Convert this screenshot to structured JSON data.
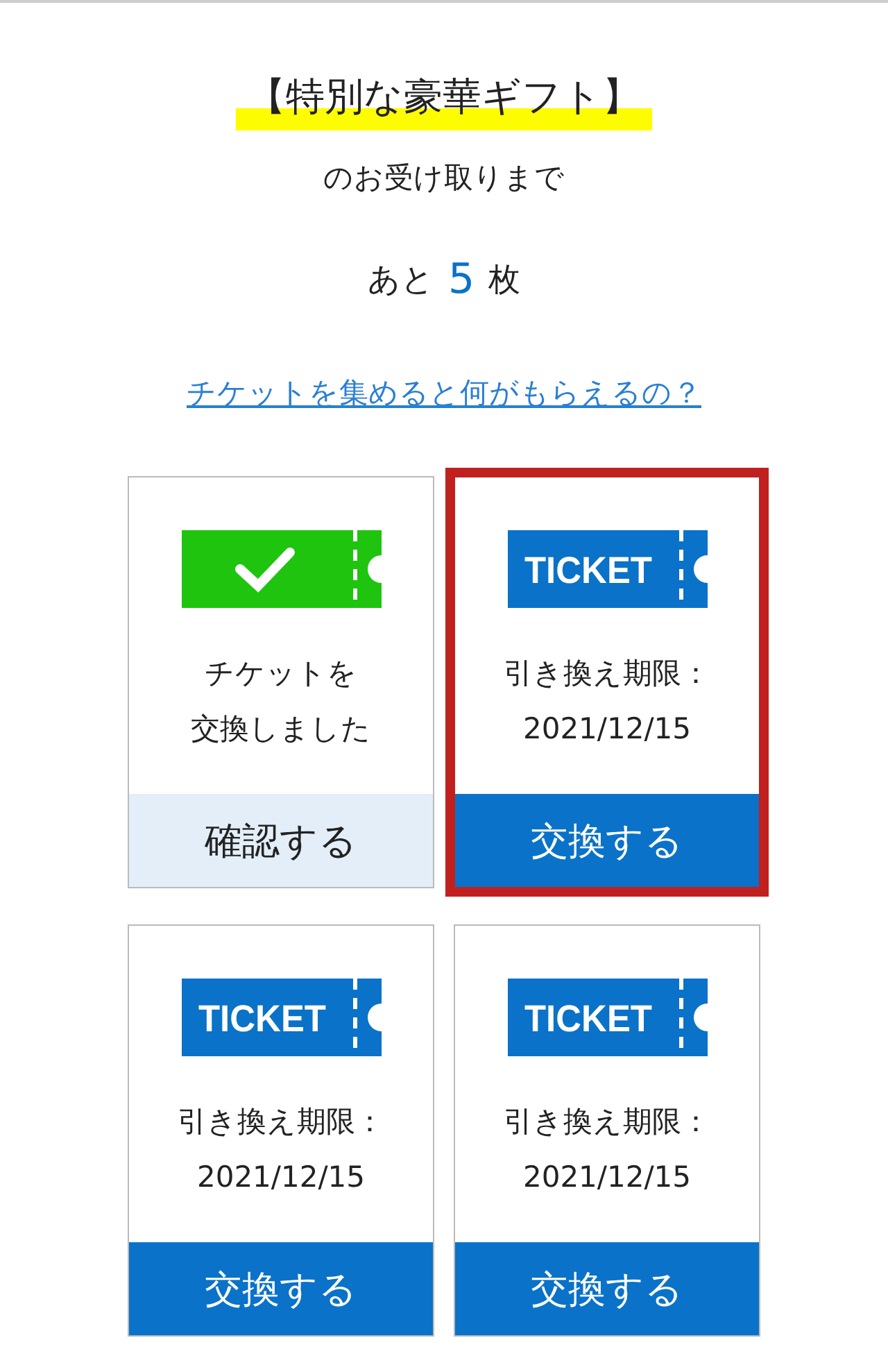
{
  "title": "【特別な豪華ギフト】",
  "subtitle": "のお受け取りまで",
  "remaining": {
    "prefix": "あと",
    "count": "5",
    "suffix": "枚"
  },
  "help_link": "チケットを集めると何がもらえるの？",
  "ticket_icon_labels": [
    "TICKET",
    "TICKET",
    "TICKET"
  ],
  "cards": [
    {
      "kind": "exchanged",
      "selected": false,
      "lines": [
        "チケットを",
        "交換しました"
      ],
      "button": "確認する"
    },
    {
      "kind": "ticket",
      "selected": true,
      "lines": [
        "引き換え期限：",
        "2021/12/15"
      ],
      "button": "交換する"
    },
    {
      "kind": "ticket",
      "selected": false,
      "lines": [
        "引き換え期限：",
        "2021/12/15"
      ],
      "button": "交換する"
    },
    {
      "kind": "ticket",
      "selected": false,
      "lines": [
        "引き換え期限：",
        "2021/12/15"
      ],
      "button": "交換する"
    }
  ]
}
